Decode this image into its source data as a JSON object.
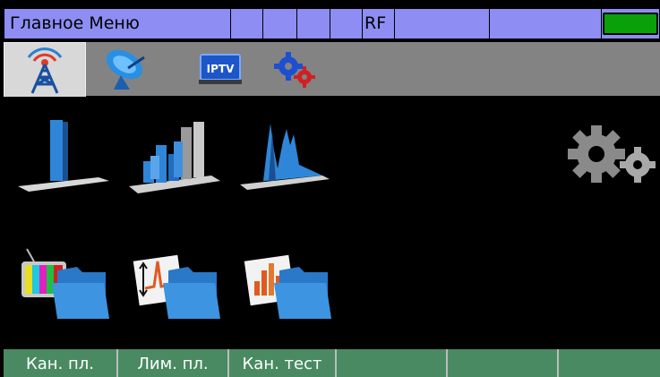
{
  "status_bar": {
    "title": "Главное Меню",
    "rf_label": "RF",
    "battery_color": "#0aa00a"
  },
  "tabs": [
    {
      "icon": "antenna-tower-icon",
      "active": true
    },
    {
      "icon": "satellite-dish-icon",
      "active": false
    },
    {
      "icon": "iptv-icon",
      "label": "IPTV",
      "active": false
    },
    {
      "icon": "settings-gears-icon",
      "active": false
    }
  ],
  "tiles": [
    {
      "icon": "single-bar-chart-icon"
    },
    {
      "icon": "multi-bar-chart-icon"
    },
    {
      "icon": "spectrum-chart-icon"
    },
    {
      "icon": "large-gears-icon"
    },
    {
      "icon": "tv-folder-icon"
    },
    {
      "icon": "limit-plan-folder-icon"
    },
    {
      "icon": "channel-test-folder-icon"
    }
  ],
  "softkeys": [
    {
      "label": "Кан. пл."
    },
    {
      "label": "Лим. пл."
    },
    {
      "label": "Кан. тест"
    },
    {
      "label": ""
    },
    {
      "label": ""
    },
    {
      "label": ""
    }
  ]
}
